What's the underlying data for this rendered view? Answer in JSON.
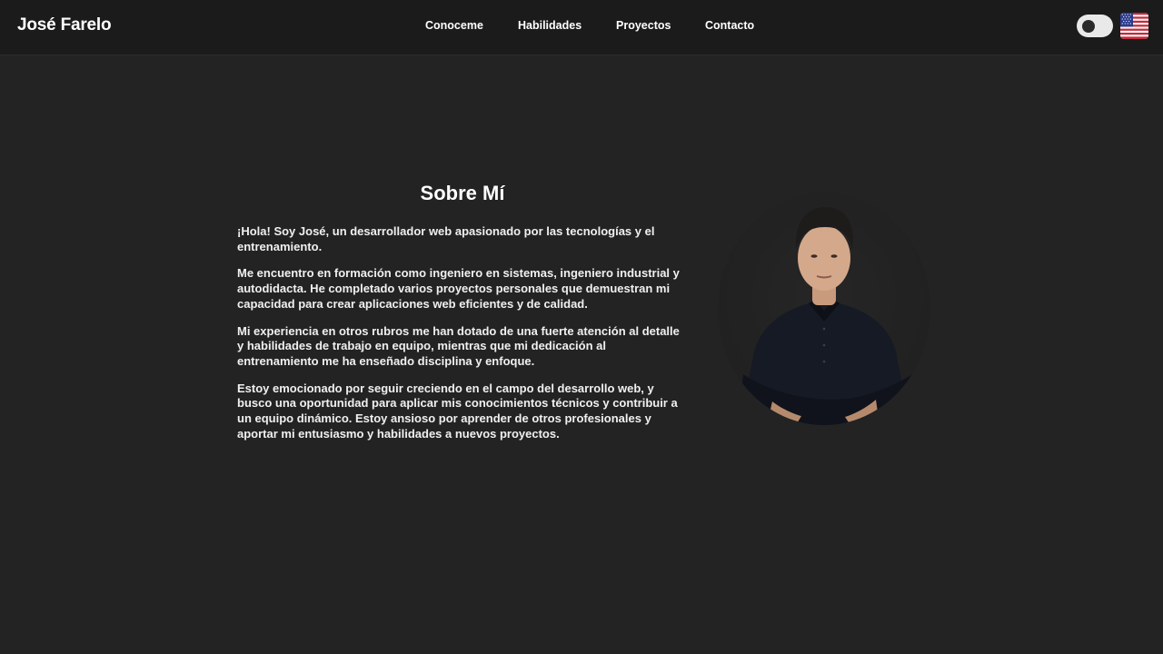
{
  "header": {
    "brand": "José Farelo",
    "nav": [
      {
        "label": "Conoceme"
      },
      {
        "label": "Habilidades"
      },
      {
        "label": "Proyectos"
      },
      {
        "label": "Contacto"
      }
    ],
    "theme_toggle": {
      "icon": "theme-toggle-switch",
      "state": "off"
    },
    "language_flag": {
      "icon": "us-flag-icon"
    }
  },
  "about": {
    "title": "Sobre Mí",
    "paragraphs": [
      "¡Hola! Soy José, un desarrollador web apasionado por las tecnologías y el entrenamiento.",
      "Me encuentro en formación como ingeniero en sistemas, ingeniero industrial y autodidacta. He completado varios proyectos personales que demuestran mi capacidad para crear aplicaciones web eficientes y de calidad.",
      "Mi experiencia en otros rubros me han dotado de una fuerte atención al detalle y habilidades de trabajo en equipo, mientras que mi dedicación al entrenamiento me ha enseñado disciplina y enfoque.",
      "Estoy emocionado por seguir creciendo en el campo del desarrollo web, y busco una oportunidad para aplicar mis conocimientos técnicos y contribuir a un equipo dinámico. Estoy ansioso por aprender de otros profesionales y aportar mi entusiasmo y habilidades a nuevos proyectos."
    ]
  },
  "colors": {
    "page_background": "#232323",
    "navbar_background": "#1b1b1b",
    "text": "#ffffff",
    "toggle_track": "#e9e9e9"
  }
}
